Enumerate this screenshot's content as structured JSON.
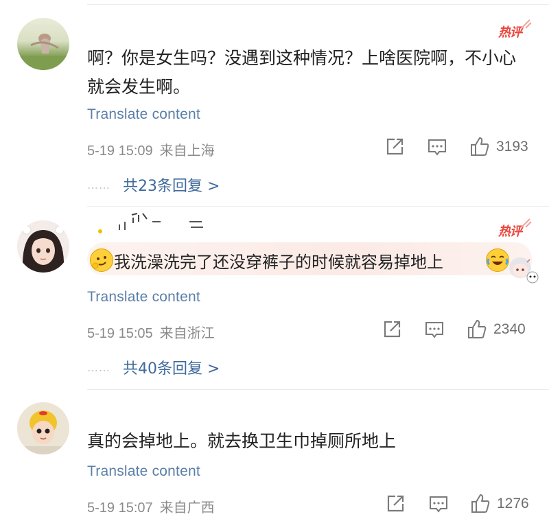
{
  "comments": [
    {
      "badge": "热评",
      "text": "啊？你是女生吗？没遇到这种情况？上啥医院啊，不小心就会发生啊。",
      "translate": "Translate content",
      "time": "5-19 15:09",
      "location": "来自上海",
      "likes": "3193",
      "replies": "共23条回复 >"
    },
    {
      "badge": "热评",
      "text": "我洗澡洗完了还没穿裤子的时候就容易掉地上",
      "translate": "Translate content",
      "time": "5-19 15:05",
      "location": "来自浙江",
      "likes": "2340",
      "replies": "共40条回复 >"
    },
    {
      "text": "真的会掉地上。就去换卫生巾掉厕所地上",
      "translate": "Translate content",
      "time": "5-19 15:07",
      "location": "来自广西",
      "likes": "1276"
    }
  ],
  "reply_dots": "……",
  "icons": [
    "share-icon",
    "comment-icon",
    "like-icon",
    "smirk-emoji-icon",
    "laugh-cry-emoji-icon",
    "hot-comment-badge-icon"
  ],
  "colors": {
    "link_blue": "#5b7fa8",
    "reply_blue": "#3f6a9a",
    "hot_red": "#e8463f",
    "meta_gray": "#8a8a8a"
  }
}
